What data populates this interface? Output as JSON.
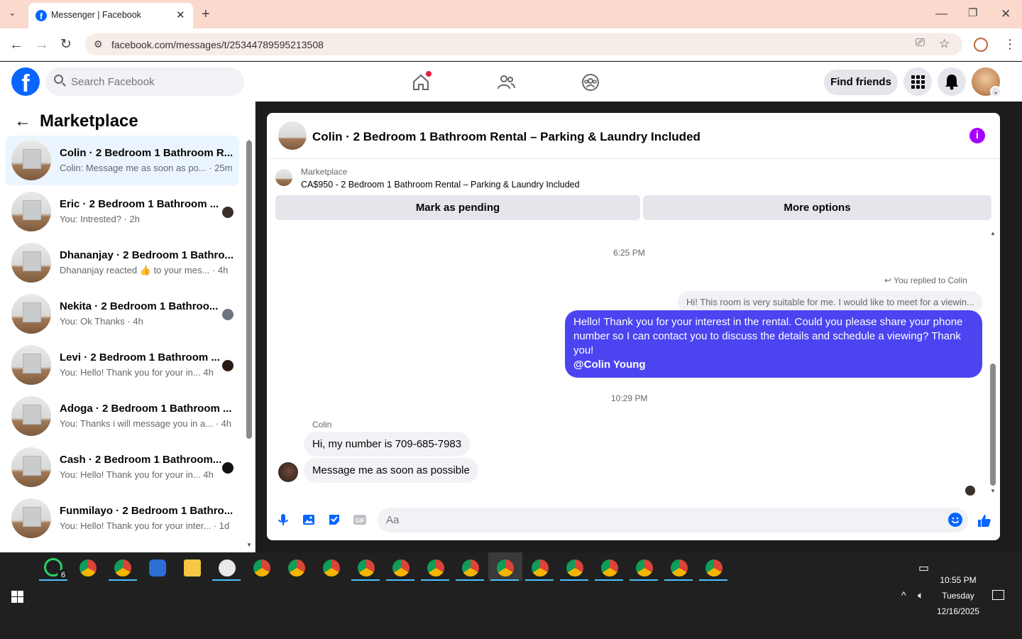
{
  "browser": {
    "tab_title": "Messenger | Facebook",
    "url": "facebook.com/messages/t/25344789595213508"
  },
  "header": {
    "search_placeholder": "Search Facebook",
    "find_friends": "Find friends"
  },
  "sidebar": {
    "title": "Marketplace",
    "conversations": [
      {
        "name": "Colin · 2 Bedroom 1 Bathroom R...",
        "preview": "Colin: Message me as soon as po... · 25m"
      },
      {
        "name": "Eric · 2 Bedroom 1 Bathroom ...",
        "preview": "You: Intrested? · 2h"
      },
      {
        "name": "Dhananjay · 2 Bedroom 1 Bathro...",
        "preview": "Dhananjay reacted 👍 to your mes... · 4h"
      },
      {
        "name": "Nekita · 2 Bedroom 1 Bathroo...",
        "preview": "You: Ok Thanks · 4h"
      },
      {
        "name": "Levi · 2 Bedroom 1 Bathroom ...",
        "preview": "You: Hello! Thank you for your in... 4h"
      },
      {
        "name": "Adoga · 2 Bedroom 1 Bathroom ...",
        "preview": "You: Thanks i will message you in a... · 4h"
      },
      {
        "name": "Cash · 2 Bedroom 1 Bathroom...",
        "preview": "You: Hello! Thank you for your in... 4h"
      },
      {
        "name": "Funmilayo · 2 Bedroom 1 Bathro...",
        "preview": "You: Hello! Thank you for your inter... · 1d"
      }
    ]
  },
  "chat": {
    "title": "Colin · 2 Bedroom 1 Bathroom Rental – Parking & Laundry Included",
    "listing_label": "Marketplace",
    "listing_desc": "CA$950 - 2 Bedroom 1 Bathroom Rental – Parking & Laundry Included",
    "mark_pending": "Mark as pending",
    "more_options": "More options",
    "time1": "6:25 PM",
    "reply_meta": "You replied to Colin",
    "reply_quote": "Hi! This room is very suitable for me. I would like to meet for a viewin...",
    "sent_text": "Hello! Thank you for your interest in the rental. Could you please share your phone number so I can contact you to discuss the details and schedule a viewing? Thank you!",
    "sent_mention": "@Colin Young",
    "time2": "10:29 PM",
    "sender_name": "Colin",
    "incoming1": "Hi, my number is 709-685-7983",
    "incoming2": "Message me as soon as possible",
    "composer_placeholder": "Aa"
  },
  "taskbar": {
    "whatsapp_badge": "6",
    "time": "10:55 PM",
    "day": "Tuesday",
    "date": "12/16/2025"
  },
  "colors": {
    "fb_blue": "#0866ff",
    "sent_bubble": "#4b44f0",
    "tab_bar": "#fbd9cd",
    "info_purple": "#a300ff"
  }
}
